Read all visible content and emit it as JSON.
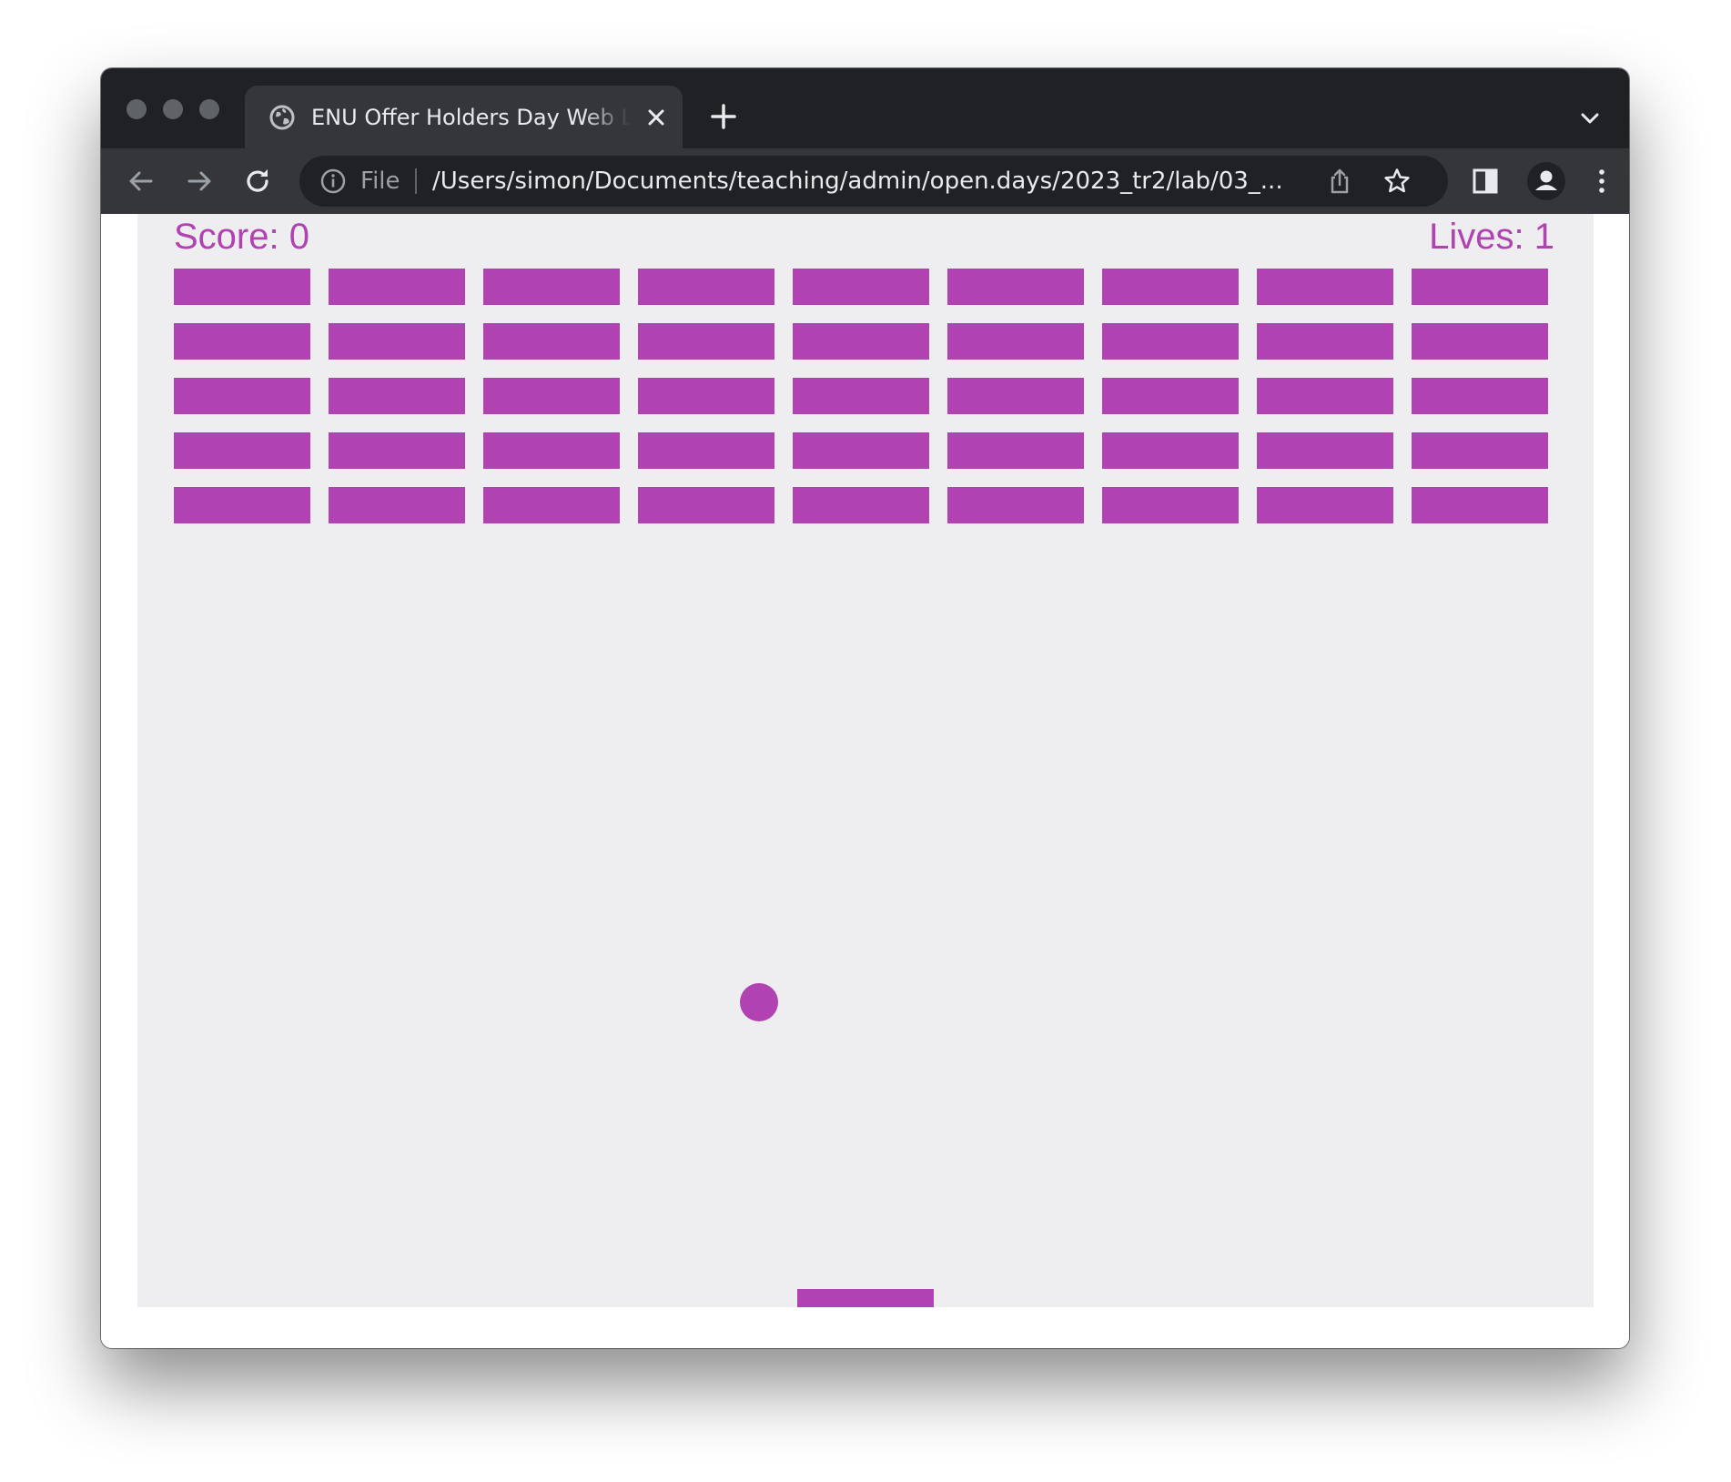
{
  "browser": {
    "tab": {
      "title": "ENU Offer Holders Day Web Lab",
      "icon": "globe-icon",
      "close_icon": "close-icon"
    },
    "new_tab_icon": "plus-icon",
    "tab_list_icon": "chevron-down-icon",
    "toolbar": {
      "back_icon": "arrow-left-icon",
      "forward_icon": "arrow-right-icon",
      "reload_icon": "reload-icon",
      "site_info_icon": "info-icon",
      "scheme": "File",
      "url": "/Users/simon/Documents/teaching/admin/open.days/2023_tr2/lab/03_...",
      "share_icon": "share-icon",
      "bookmark_icon": "star-icon",
      "side_panel_icon": "side-panel-icon",
      "profile_icon": "profile-icon",
      "menu_icon": "kebab-menu-icon"
    }
  },
  "game": {
    "score_text": "Score: 0",
    "lives_text": "Lives: 1",
    "score": 0,
    "lives": 1,
    "brick_rows": 5,
    "brick_columns": 9,
    "colors": {
      "accent": "#b142b1",
      "canvas_background": "#eeedef",
      "chrome_dark": "#202124",
      "chrome_toolbar": "#35363a"
    }
  }
}
